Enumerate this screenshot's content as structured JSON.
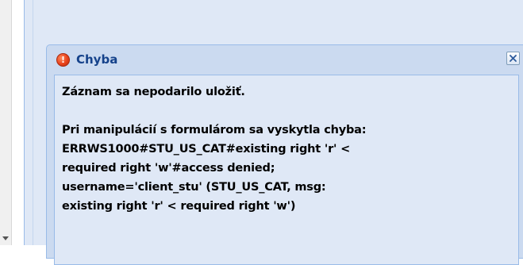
{
  "dialog": {
    "title": "Chyba",
    "icon": "error-icon",
    "close_icon": "close-icon",
    "message": {
      "summary": "Záznam sa nepodarilo uložiť.",
      "detail_lines": [
        "Pri manipulácií s formulárom sa vyskytla chyba:",
        "ERRWS1000#STU_US_CAT#existing right 'r' <",
        "required right 'w'#access denied;",
        "username='client_stu' (STU_US_CAT, msg:",
        "existing right 'r' < required right 'w')"
      ]
    }
  },
  "colors": {
    "title_text": "#15428b",
    "panel_bg": "#dfe8f6",
    "header_bg": "#cbdaf0",
    "border": "#99bbe8",
    "error_icon": "#e8421c"
  }
}
